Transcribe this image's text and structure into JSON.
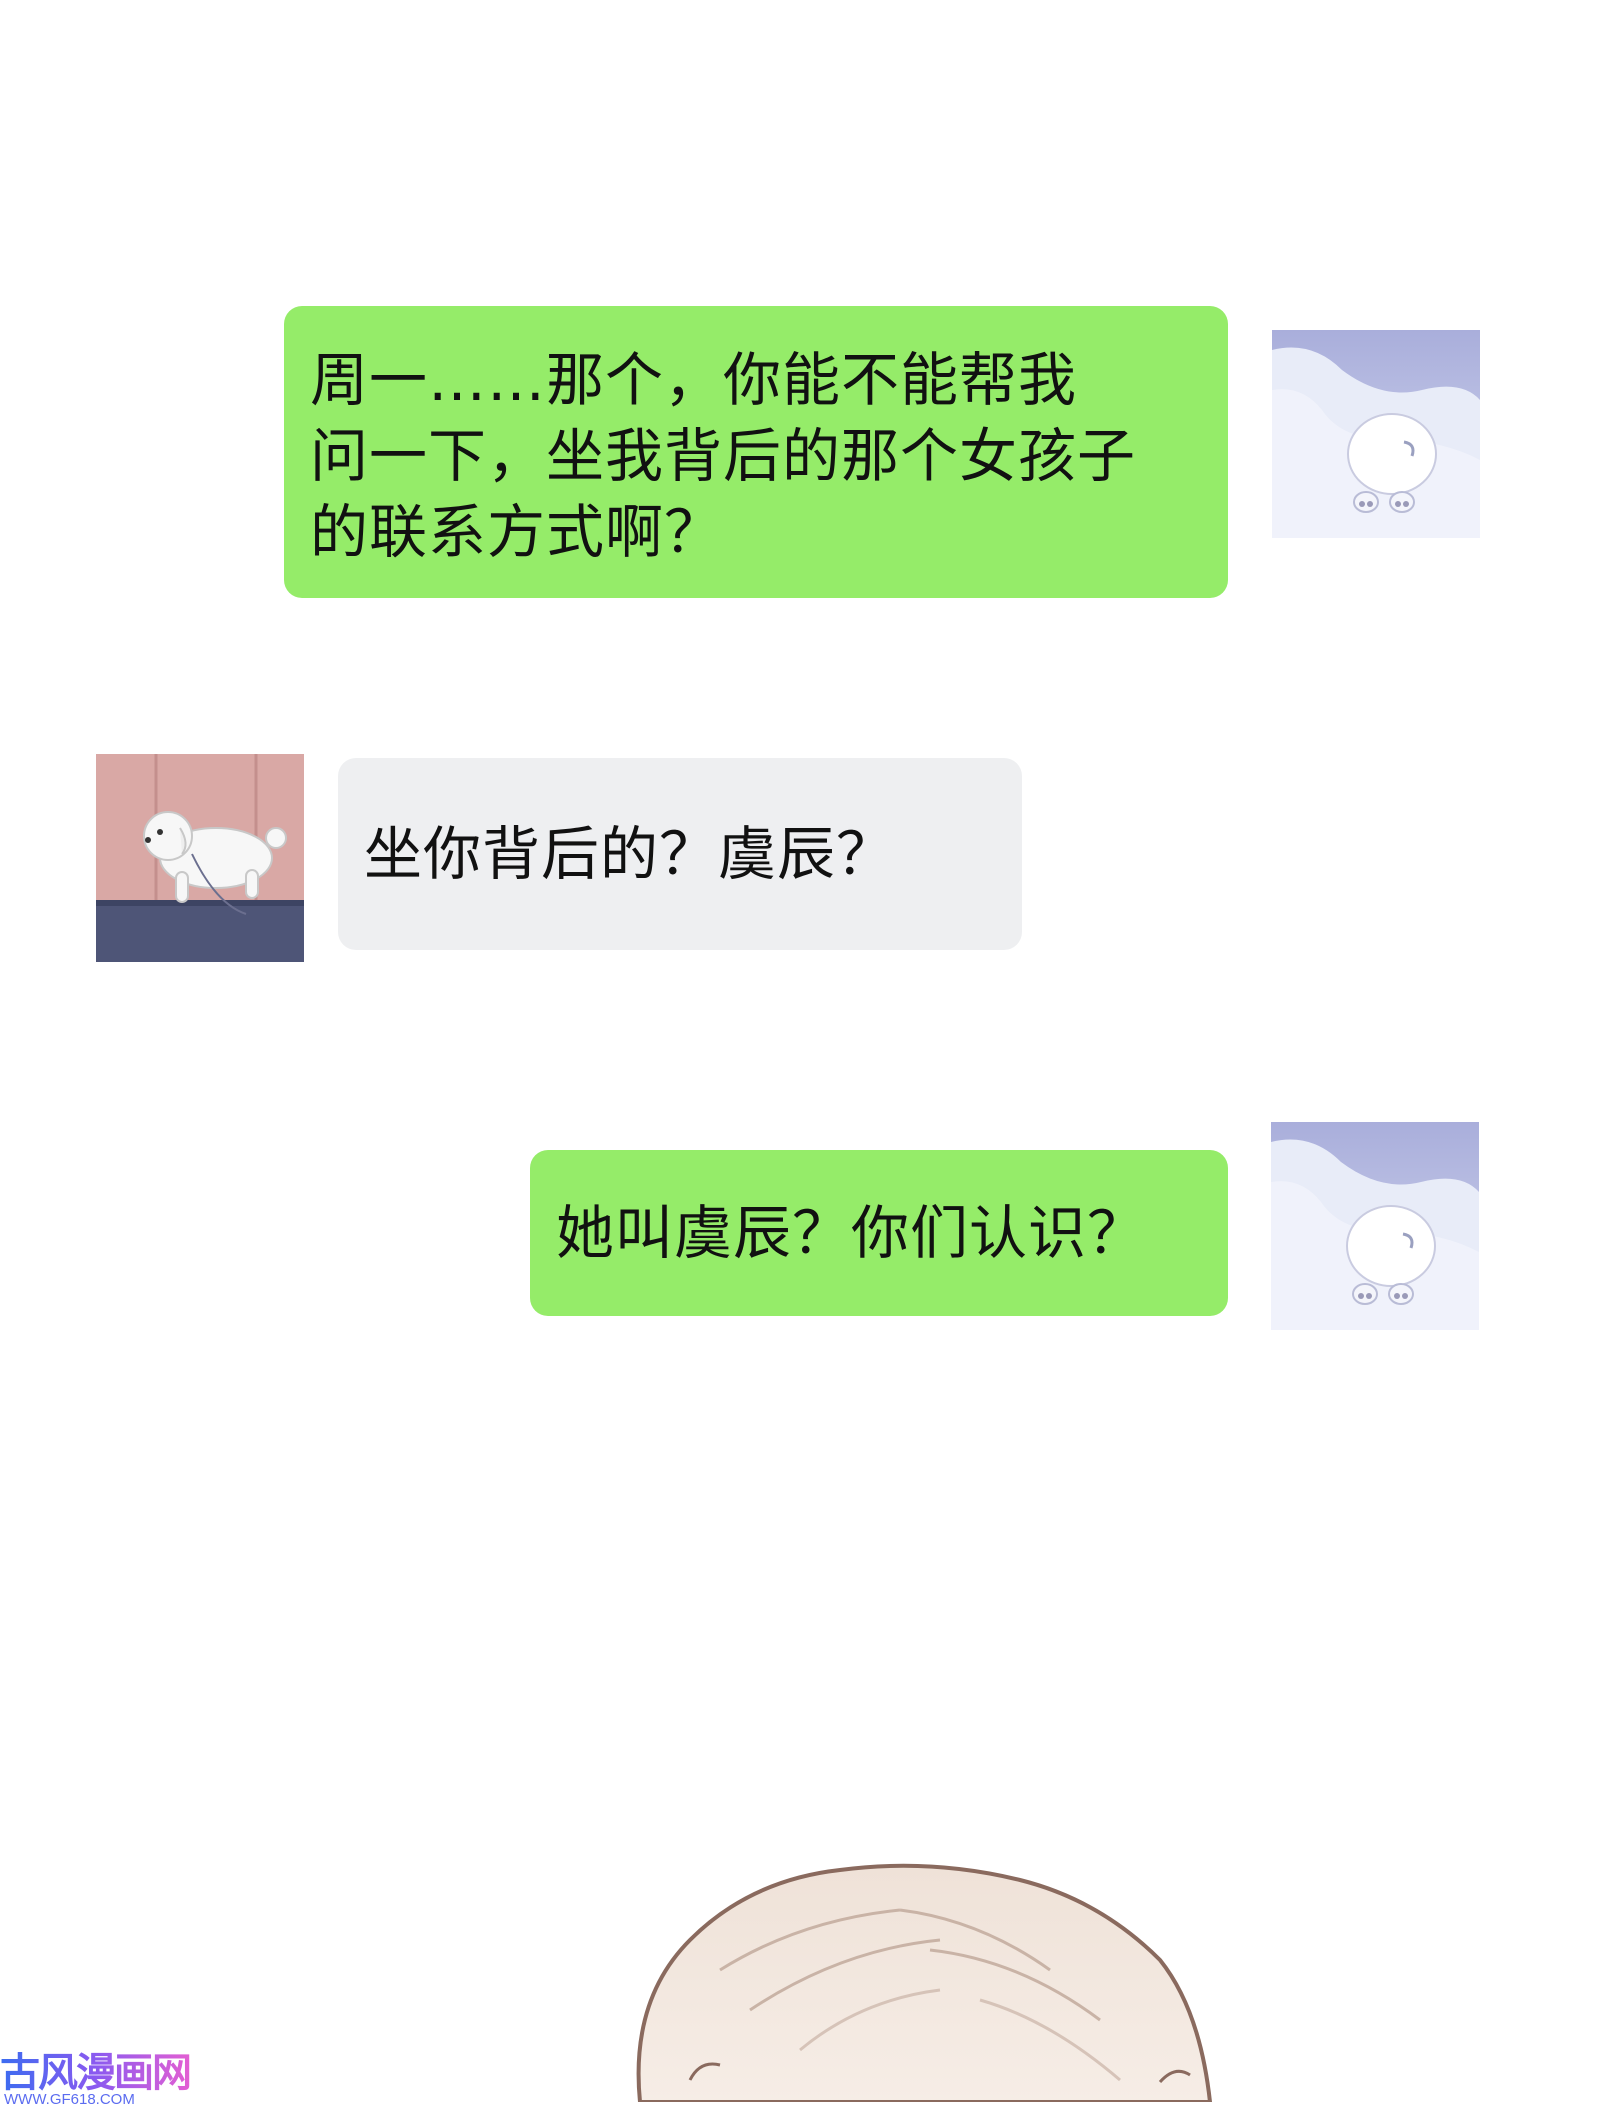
{
  "colors": {
    "sent_bubble": "#95ec69",
    "received_bubble": "#eeeff1",
    "text": "#111111",
    "background": "#ffffff"
  },
  "messages": [
    {
      "side": "sent",
      "avatar": "polar-bear-avatar",
      "lines": [
        "周一……那个，你能不能帮我",
        "问一下，坐我背后的那个女孩子",
        "的联系方式啊？"
      ]
    },
    {
      "side": "received",
      "avatar": "white-dog-avatar",
      "lines": [
        "坐你背后的？虞辰？"
      ]
    },
    {
      "side": "sent",
      "avatar": "polar-bear-avatar",
      "lines": [
        "她叫虞辰？你们认识？"
      ]
    }
  ],
  "watermark": {
    "title": "古风漫画网",
    "url": "WWW.GF618.COM"
  }
}
